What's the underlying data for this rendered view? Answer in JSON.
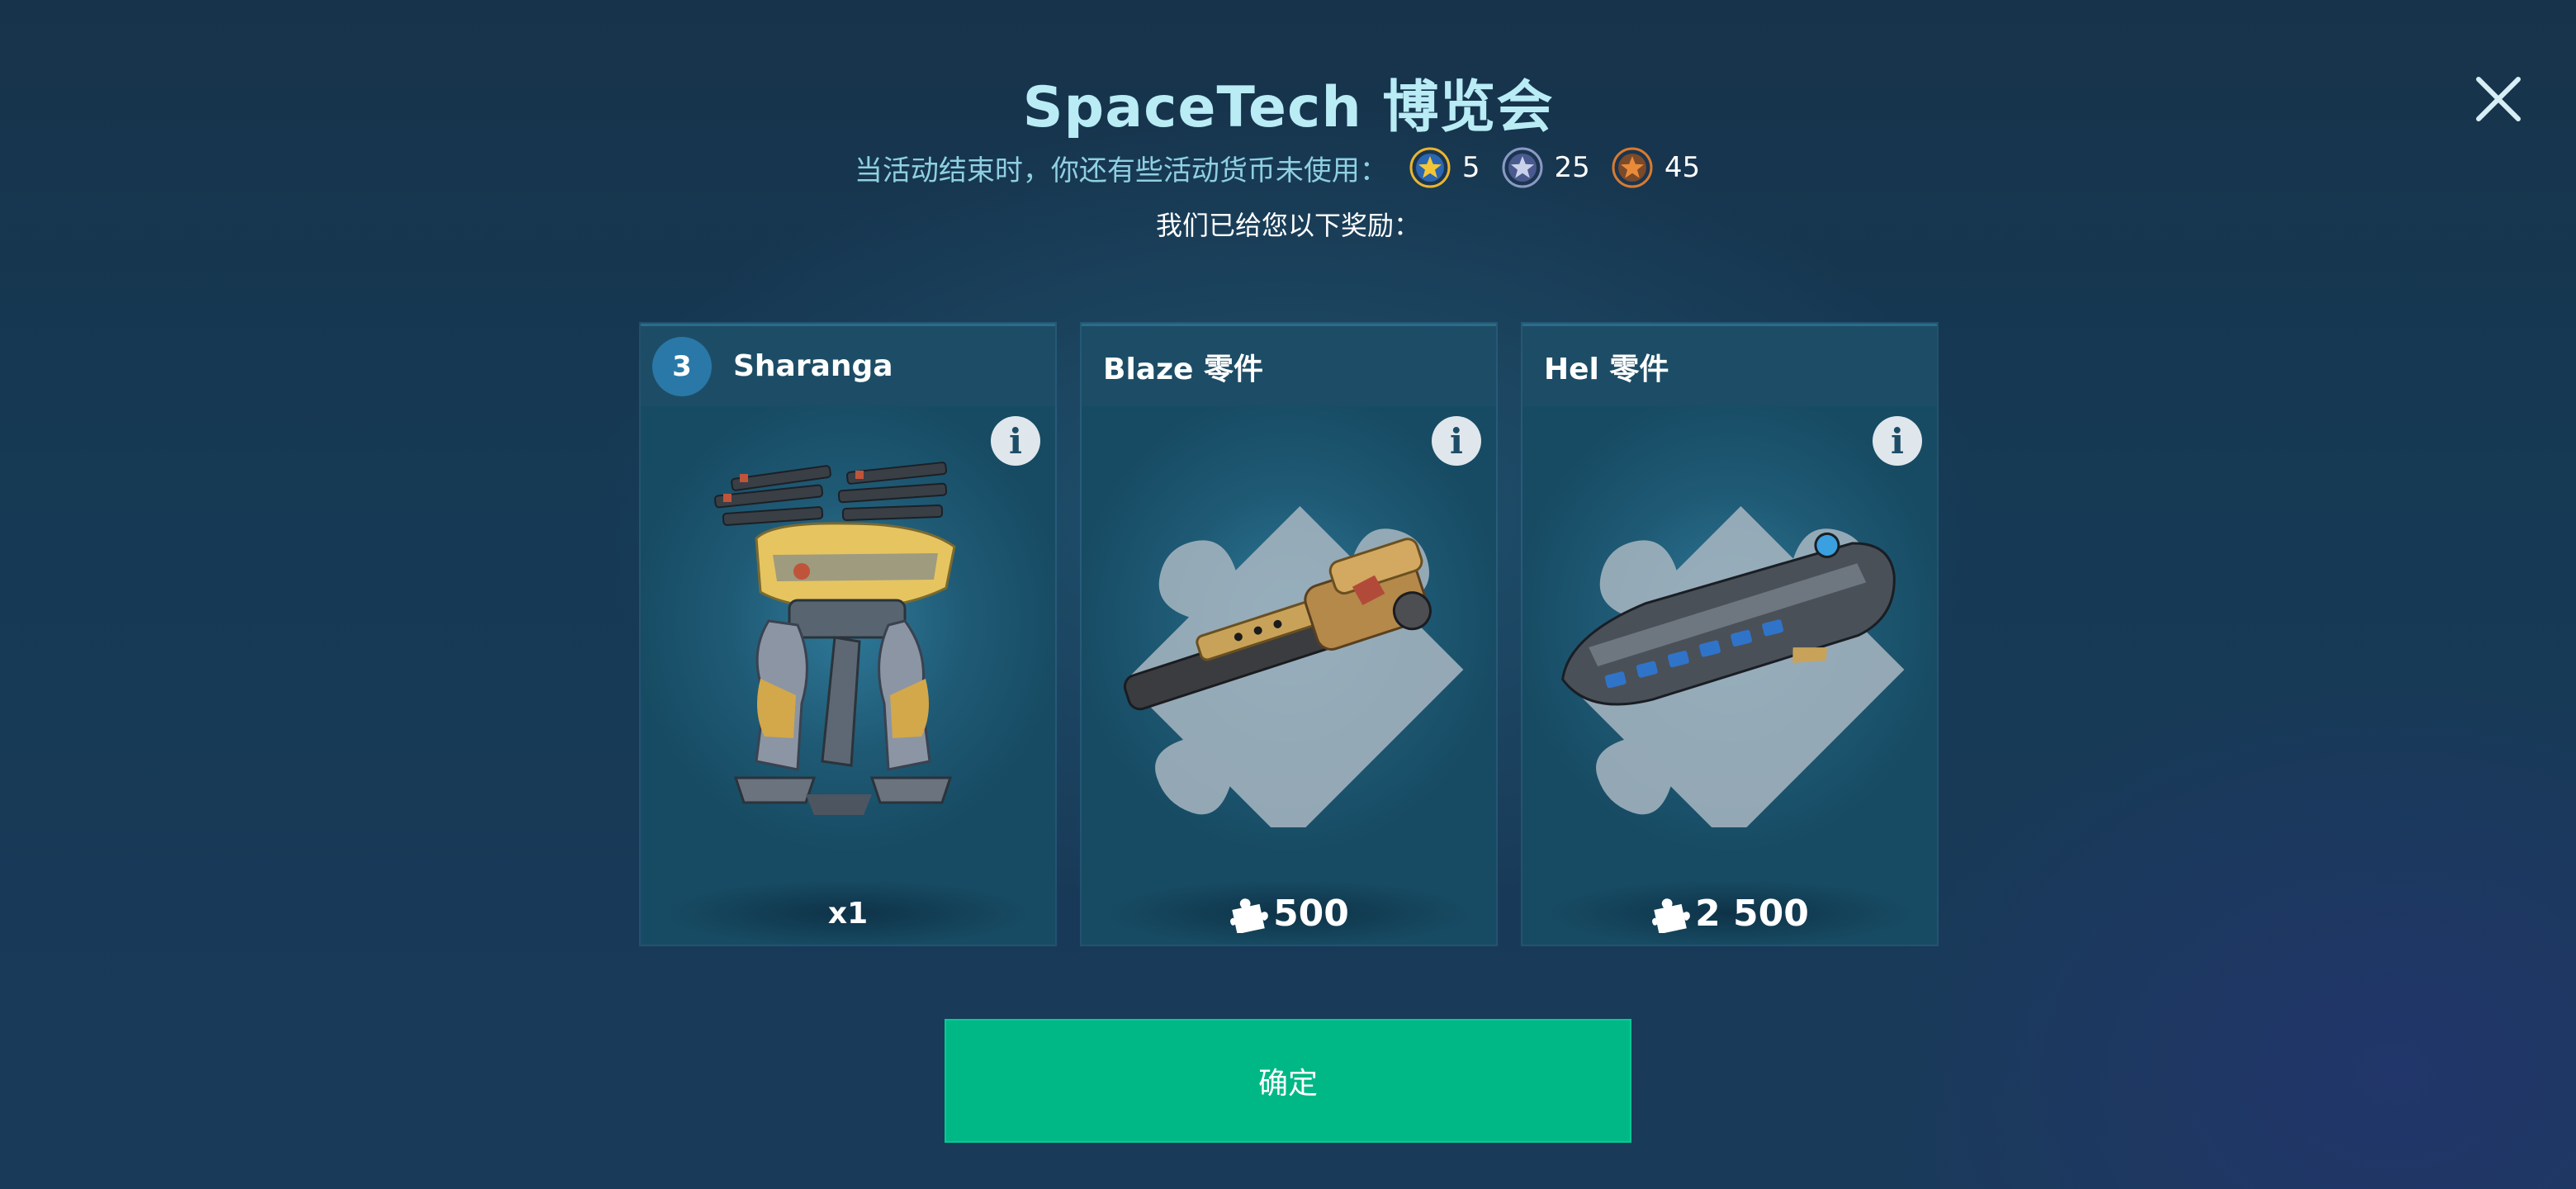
{
  "header": {
    "title": "SpaceTech 博览会",
    "close_icon": "close-icon"
  },
  "currency_notice": {
    "message": "当活动结束时，你还有些活动货币未使用：",
    "currencies": [
      {
        "icon": "gold-star-coin-icon",
        "amount": "5",
        "color": "#e8b530"
      },
      {
        "icon": "silver-star-coin-icon",
        "amount": "25",
        "color": "#8a9ac4"
      },
      {
        "icon": "bronze-star-coin-icon",
        "amount": "45",
        "color": "#d97a2e"
      }
    ]
  },
  "reward_message": "我们已给您以下奖励：",
  "cards": [
    {
      "badge": "3",
      "name": "Sharanga",
      "footer": "x1",
      "icon": "robot-icon"
    },
    {
      "name": "Blaze 零件",
      "footer": "500",
      "icon": "puzzle-piece-icon"
    },
    {
      "name": "Hel 零件",
      "footer": "2 500",
      "icon": "puzzle-piece-icon"
    }
  ],
  "confirm_button": "确定",
  "colors": {
    "accent": "#00b886",
    "title": "#b9ecf5",
    "subtitle": "#8fd0e0"
  }
}
